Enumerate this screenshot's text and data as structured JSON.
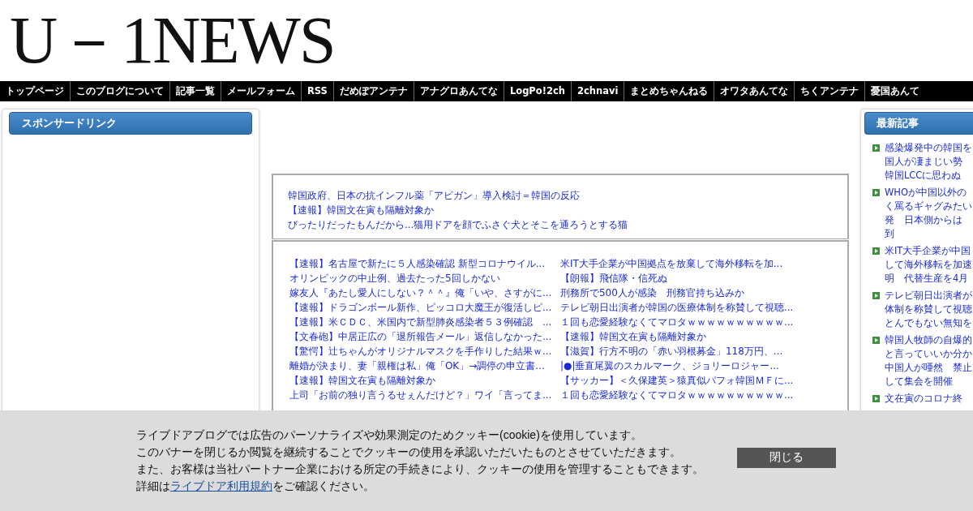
{
  "header": {
    "logo": "U－1NEWS"
  },
  "nav": [
    "トップページ",
    "このブログについて",
    "記事一覧",
    "メールフォーム",
    "RSS",
    "だめぽアンテナ",
    "アナグロあんてな",
    "LogPo!2ch",
    "2chnavi",
    "まとめちゃんねる",
    "オワタあんてな",
    "ちくアンテナ",
    "憂国あんて"
  ],
  "left_sidebar": {
    "title": "スポンサードリンク"
  },
  "top_links": [
    "韓国政府、日本の抗インフル薬「アビガン」導入検討＝韓国の反応",
    "【速報】韓国文在寅も隔離対象か",
    "ぴったりだったもんだから...猫用ドアを顔でふさぐ犬とそこを通ろうとする猫"
  ],
  "link_grid": {
    "column_1": [
      "【速報】名古屋で新たに５人感染確認 新型コロナウイル...",
      "オリンピックの中止例、過去たった5回しかない",
      "嫁友人『あたし愛人にしない？＾＾』俺「いや、さすがに...",
      "【速報】ドラゴンボール新作、ピッコロ大魔王が復活しピ...",
      "【速報】米ＣＤＣ、米国内で新型肺炎感染者５３例確認　...",
      "【文春砲】中居正広の「退所報告メール」返信しなかった...",
      "【驚愕】辻ちゃんがオリジナルマスクを手作りした結果ｗ...",
      "離婚が決まり、妻「親権は私」俺「OK」→調停の申立書...",
      "【速報】韓国文在寅も隔離対象か",
      "上司「お前の独り言うるせぇんだけど？」ワイ「言ってま..."
    ],
    "column_2": [
      "米IT大手企業が中国拠点を放棄して海外移転を加...",
      "【朗報】飛信隊・信死ぬ",
      "刑務所で500人が感染　刑務官持ち込みか",
      "テレビ朝日出演者が韓国の医療体制を称賛して視聴...",
      "１回も恋愛経験なくてマロタｗｗｗｗｗｗｗｗｗｗ...",
      "【速報】韓国文在寅も隔離対象か",
      "【滋賀】行方不明の「赤い羽根募金」118万円、...",
      "|●|垂直尾翼のスカルマーク、ジョリーロジャー...",
      "【サッカー】＜久保建英＞猿真似パフォ韓国ＭＦに...",
      "１回も恋愛経験なくてマロタｗｗｗｗｗｗｗｗｗｗ..."
    ]
  },
  "right_sidebar": {
    "title": "最新記事",
    "entries": [
      {
        "lines": [
          "感染爆発中の韓国を",
          "国人が凄まじい勢",
          "韓国LCCに思わぬ"
        ]
      },
      {
        "lines": [
          "WHOが中国以外の",
          "く罵るギャグみたい",
          "発　日本側からは",
          "到"
        ]
      },
      {
        "lines": [
          "米IT大手企業が中国",
          "して海外移転を加速",
          "明　代替生産を4月"
        ]
      },
      {
        "lines": [
          "テレビ朝日出演者が",
          "体制を称賛して視聴",
          "とんでもない無知を"
        ]
      },
      {
        "lines": [
          "韓国人牧師の自爆的",
          "と言っていいか分か",
          "中国人が唖然　禁止",
          "して集会を開催"
        ]
      },
      {
        "lines": [
          "文在寅のコロナ終"
        ]
      }
    ]
  },
  "cookie_banner": {
    "lines": [
      "ライブドアブログでは広告のパーソナライズや効果測定のためクッキー(cookie)を使用しています。",
      "このバナーを閉じるか閲覧を継続することでクッキーの使用を承認いただいたものとさせていただきます。",
      "また、お客様は当社パートナー企業における所定の手続きにより、クッキーの使用を管理することもできます。"
    ],
    "last_line": {
      "before": "詳細は",
      "link": "ライブドア利用規約",
      "after": "をご確認ください。"
    },
    "close_button": "閉じる"
  }
}
